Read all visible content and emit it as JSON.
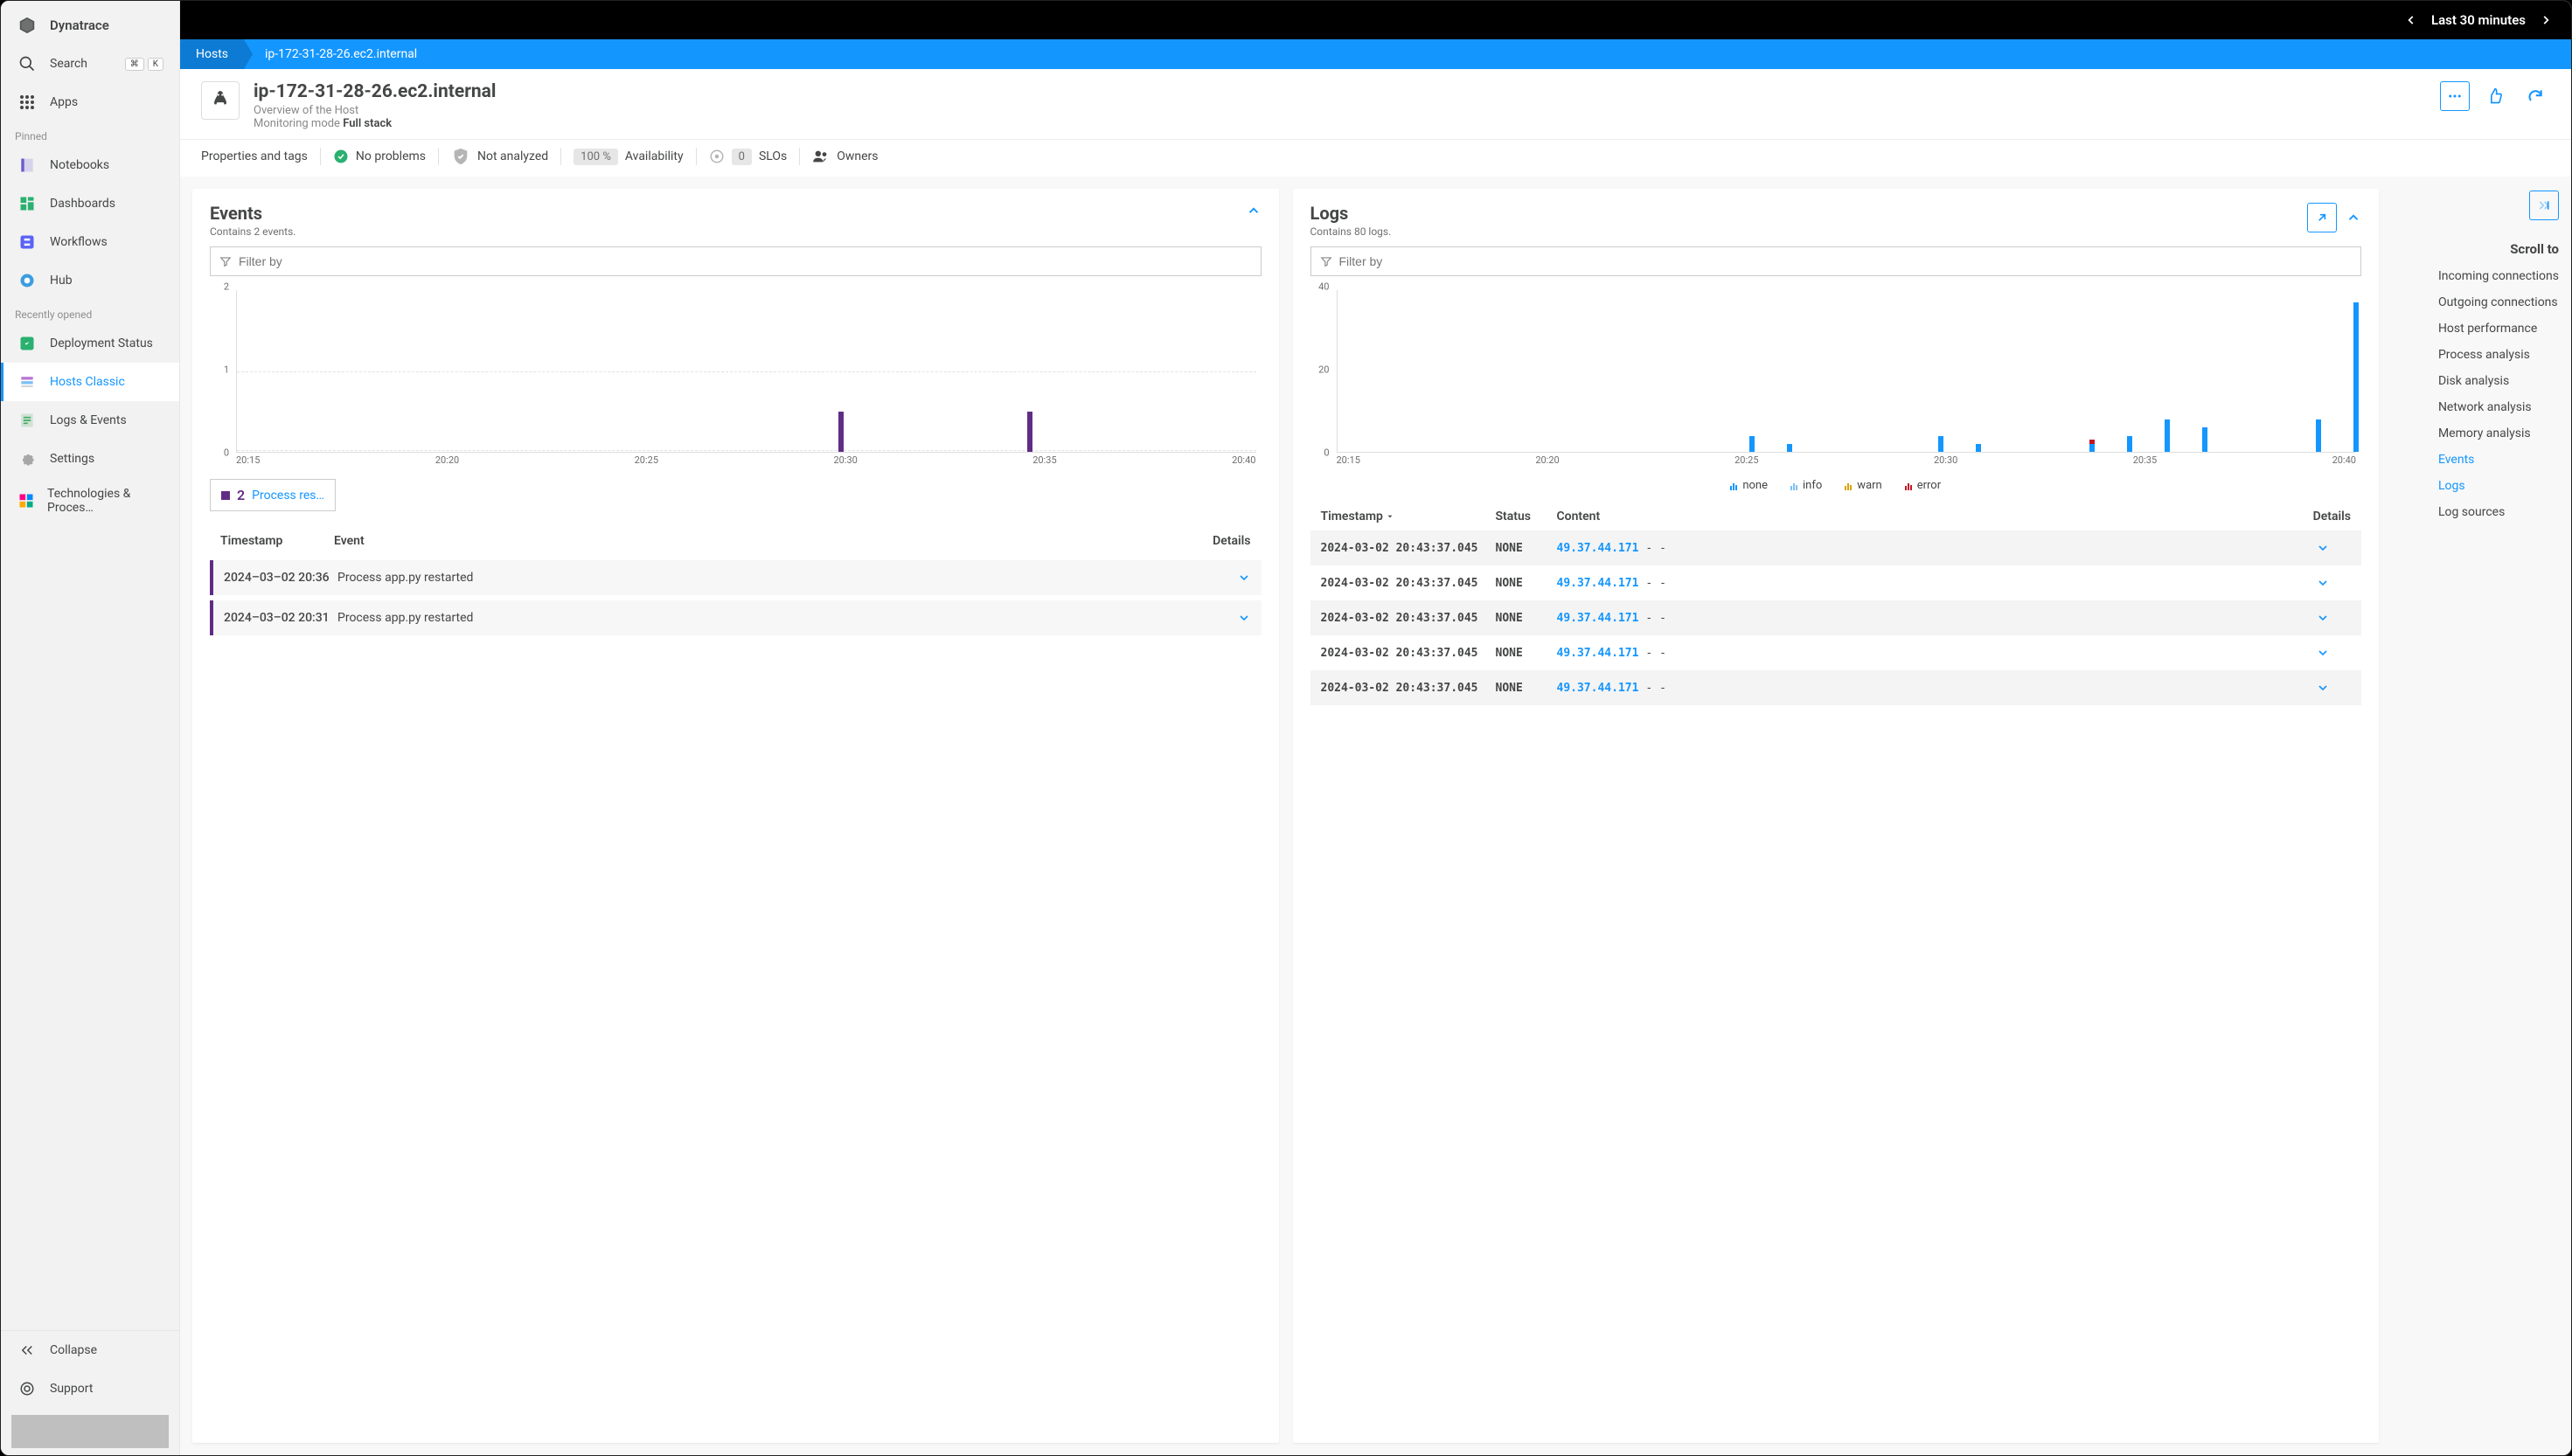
{
  "brand": "Dynatrace",
  "timerange": "Last 30 minutes",
  "sidebar": {
    "search": "Search",
    "kbd1": "⌘",
    "kbd2": "K",
    "apps": "Apps",
    "pinned_label": "Pinned",
    "pinned": [
      "Notebooks",
      "Dashboards",
      "Workflows",
      "Hub"
    ],
    "recent_label": "Recently opened",
    "recent": [
      "Deployment Status",
      "Hosts Classic",
      "Logs & Events",
      "Settings",
      "Technologies & Proces…"
    ],
    "collapse": "Collapse",
    "support": "Support"
  },
  "breadcrumb": {
    "root": "Hosts",
    "current": "ip-172-31-28-26.ec2.internal"
  },
  "header": {
    "title": "ip-172-31-28-26.ec2.internal",
    "subtitle": "Overview of the Host",
    "mode_label": "Monitoring mode ",
    "mode_value": "Full stack"
  },
  "statusbar": {
    "props": "Properties and tags",
    "no_problems": "No problems",
    "not_analyzed": "Not analyzed",
    "avail_pct": "100 %",
    "avail_label": "Availability",
    "slo_count": "0",
    "slo_label": "SLOs",
    "owners": "Owners"
  },
  "events": {
    "title": "Events",
    "subtitle": "Contains 2 events.",
    "filter_placeholder": "Filter by",
    "legend_count": "2",
    "legend_label": "Process res…",
    "th_timestamp": "Timestamp",
    "th_event": "Event",
    "th_details": "Details",
    "rows": [
      {
        "ts": "2024–03–02 20:36",
        "name": "Process app.py restarted"
      },
      {
        "ts": "2024–03–02 20:31",
        "name": "Process app.py restarted"
      }
    ]
  },
  "logs": {
    "title": "Logs",
    "subtitle": "Contains 80 logs.",
    "filter_placeholder": "Filter by",
    "legend": {
      "none": "none",
      "info": "info",
      "warn": "warn",
      "error": "error"
    },
    "th_timestamp": "Timestamp",
    "th_status": "Status",
    "th_content": "Content",
    "th_details": "Details",
    "rows": [
      {
        "ts": "2024-03-02 20:43:37.045",
        "status": "NONE",
        "ip": "49.37.44.171",
        "rest": "-  -"
      },
      {
        "ts": "2024-03-02 20:43:37.045",
        "status": "NONE",
        "ip": "49.37.44.171",
        "rest": "-  -"
      },
      {
        "ts": "2024-03-02 20:43:37.045",
        "status": "NONE",
        "ip": "49.37.44.171",
        "rest": "-  -"
      },
      {
        "ts": "2024-03-02 20:43:37.045",
        "status": "NONE",
        "ip": "49.37.44.171",
        "rest": "-  -"
      },
      {
        "ts": "2024-03-02 20:43:37.045",
        "status": "NONE",
        "ip": "49.37.44.171",
        "rest": "-  -"
      }
    ]
  },
  "scrollto": {
    "title": "Scroll to",
    "links": [
      "Incoming connections",
      "Outgoing connections",
      "Host performance",
      "Process analysis",
      "Disk analysis",
      "Network analysis",
      "Memory analysis",
      "Events",
      "Logs",
      "Log sources"
    ],
    "active": [
      "Events",
      "Logs"
    ]
  },
  "chart_data": [
    {
      "type": "bar",
      "title": "Events",
      "x_ticks": [
        "20:15",
        "20:20",
        "20:25",
        "20:30",
        "20:35",
        "20:40"
      ],
      "ylim": [
        0,
        2
      ],
      "y_ticks": [
        0,
        1,
        2
      ],
      "series": [
        {
          "name": "Process restarted",
          "color": "#612c85",
          "points": [
            {
              "x": "20:31",
              "value": 1
            },
            {
              "x": "20:36",
              "value": 1
            }
          ]
        }
      ]
    },
    {
      "type": "bar-stacked",
      "title": "Logs",
      "x_ticks": [
        "20:15",
        "20:20",
        "20:25",
        "20:30",
        "20:35",
        "20:40"
      ],
      "ylim": [
        0,
        40
      ],
      "y_ticks": [
        0,
        20,
        40
      ],
      "series": [
        {
          "name": "none",
          "color": "#1496ff"
        },
        {
          "name": "info",
          "color": "#7cc0f4"
        },
        {
          "name": "warn",
          "color": "#d9a300"
        },
        {
          "name": "error",
          "color": "#c41425"
        }
      ],
      "bars": [
        {
          "x": "20:26",
          "none": 4
        },
        {
          "x": "20:27",
          "none": 2
        },
        {
          "x": "20:31",
          "none": 4
        },
        {
          "x": "20:32",
          "none": 2
        },
        {
          "x": "20:35",
          "none": 2,
          "error": 1
        },
        {
          "x": "20:36",
          "none": 4
        },
        {
          "x": "20:37",
          "none": 8
        },
        {
          "x": "20:38",
          "none": 6
        },
        {
          "x": "20:41",
          "none": 8
        },
        {
          "x": "20:42",
          "none": 37
        }
      ]
    }
  ]
}
